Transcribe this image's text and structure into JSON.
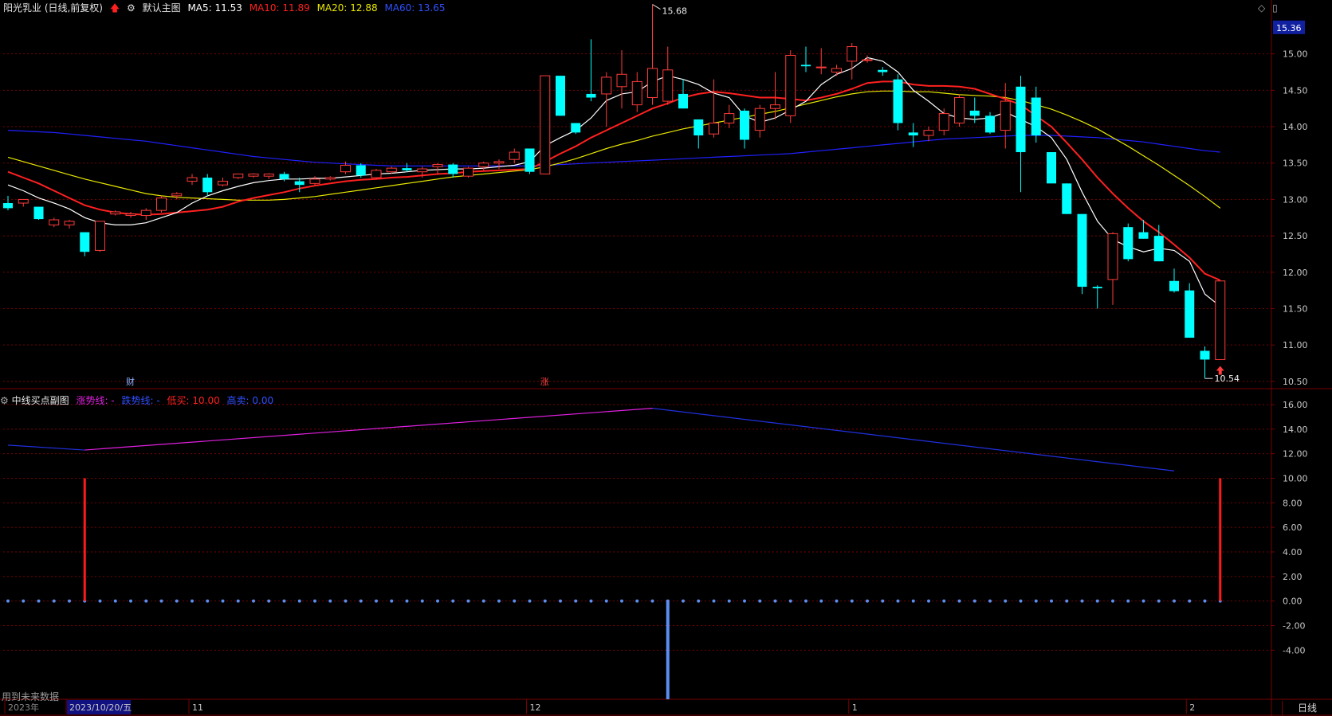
{
  "main_header": {
    "stock_name": "阳光乳业 (日线,前复权)",
    "template": "默认主图",
    "ma5_label": "MA5: 11.53",
    "ma10_label": "MA10: 11.89",
    "ma20_label": "MA20: 12.88",
    "ma60_label": "MA60: 13.65"
  },
  "sub_header": {
    "title": "中线买点副图",
    "rise_line": "涨势线: -",
    "fall_line": "跌势线: -",
    "low_buy": "低买: 10.00",
    "high_sell": "高卖: 0.00"
  },
  "status": {
    "future_data_note": "用到未来数据",
    "period_button": "日线"
  },
  "colors": {
    "bull": "#ff3b3b",
    "bear": "#00ffff",
    "ma5": "#ffffff",
    "ma10": "#ff2020",
    "ma20": "#e8e800",
    "ma60": "#2020ff",
    "rise": "#e020e0",
    "fall": "#2030e0",
    "grid": "#7a0000"
  },
  "chart_data": [
    {
      "type": "candlestick",
      "title": "阳光乳业 (日线,前复权)",
      "ylim": [
        10.4,
        15.5
      ],
      "y_ticks": [
        "15.00",
        "14.50",
        "14.00",
        "13.50",
        "13.00",
        "12.50",
        "12.00",
        "11.50",
        "11.00",
        "10.50"
      ],
      "last_price_label": "15.36",
      "high_annotation": "15.68",
      "low_annotation": "10.54",
      "event_markers": [
        {
          "text": "财",
          "index": 8
        },
        {
          "text": "涨",
          "index": 35
        }
      ],
      "x_labels": [
        {
          "text": "2023年",
          "index": 0
        },
        {
          "text": "2023/10/20/五",
          "index": 4
        },
        {
          "text": "11",
          "index": 12
        },
        {
          "text": "12",
          "index": 34
        },
        {
          "text": "1",
          "index": 55
        },
        {
          "text": "2",
          "index": 77
        }
      ],
      "ohlc": [
        [
          12.95,
          13.05,
          12.85,
          12.88
        ],
        [
          12.95,
          13.0,
          12.9,
          13.0
        ],
        [
          12.9,
          12.9,
          12.72,
          12.73
        ],
        [
          12.65,
          12.75,
          12.62,
          12.72
        ],
        [
          12.65,
          12.72,
          12.6,
          12.7
        ],
        [
          12.55,
          12.55,
          12.22,
          12.28
        ],
        [
          12.3,
          12.7,
          12.28,
          12.7
        ],
        [
          12.8,
          12.85,
          12.78,
          12.83
        ],
        [
          12.78,
          12.83,
          12.75,
          12.8
        ],
        [
          12.78,
          12.88,
          12.72,
          12.85
        ],
        [
          12.85,
          13.05,
          12.82,
          13.02
        ],
        [
          13.05,
          13.1,
          13.0,
          13.08
        ],
        [
          13.25,
          13.35,
          13.2,
          13.3
        ],
        [
          13.3,
          13.35,
          13.05,
          13.1
        ],
        [
          13.2,
          13.3,
          13.18,
          13.25
        ],
        [
          13.3,
          13.35,
          13.28,
          13.35
        ],
        [
          13.32,
          13.36,
          13.3,
          13.35
        ],
        [
          13.32,
          13.36,
          13.28,
          13.35
        ],
        [
          13.35,
          13.38,
          13.25,
          13.28
        ],
        [
          13.25,
          13.3,
          13.1,
          13.2
        ],
        [
          13.22,
          13.32,
          13.2,
          13.28
        ],
        [
          13.28,
          13.32,
          13.26,
          13.3
        ],
        [
          13.38,
          13.52,
          13.35,
          13.47
        ],
        [
          13.47,
          13.5,
          13.3,
          13.33
        ],
        [
          13.3,
          13.42,
          13.28,
          13.4
        ],
        [
          13.38,
          13.45,
          13.35,
          13.43
        ],
        [
          13.43,
          13.5,
          13.38,
          13.4
        ],
        [
          13.38,
          13.45,
          13.3,
          13.42
        ],
        [
          13.45,
          13.5,
          13.35,
          13.48
        ],
        [
          13.48,
          13.5,
          13.3,
          13.35
        ],
        [
          13.32,
          13.45,
          13.3,
          13.43
        ],
        [
          13.45,
          13.52,
          13.4,
          13.5
        ],
        [
          13.5,
          13.55,
          13.42,
          13.52
        ],
        [
          13.55,
          13.7,
          13.5,
          13.65
        ],
        [
          13.7,
          13.7,
          13.35,
          13.38
        ],
        [
          13.35,
          14.7,
          13.35,
          14.7
        ],
        [
          14.7,
          14.7,
          14.15,
          14.15
        ],
        [
          14.05,
          14.05,
          13.9,
          13.92
        ],
        [
          14.45,
          15.2,
          14.35,
          14.4
        ],
        [
          14.45,
          14.75,
          14.0,
          14.68
        ],
        [
          14.55,
          15.05,
          14.25,
          14.72
        ],
        [
          14.3,
          14.75,
          14.2,
          14.62
        ],
        [
          14.4,
          15.68,
          14.3,
          14.8
        ],
        [
          14.35,
          15.1,
          14.3,
          14.78
        ],
        [
          14.45,
          14.65,
          14.25,
          14.25
        ],
        [
          14.1,
          14.1,
          13.7,
          13.88
        ],
        [
          13.9,
          14.65,
          13.85,
          14.05
        ],
        [
          14.05,
          14.3,
          13.98,
          14.18
        ],
        [
          14.22,
          14.25,
          13.7,
          13.82
        ],
        [
          13.95,
          14.3,
          13.85,
          14.25
        ],
        [
          14.25,
          14.75,
          14.1,
          14.3
        ],
        [
          14.15,
          15.05,
          14.05,
          14.98
        ],
        [
          14.85,
          15.1,
          14.75,
          14.83
        ],
        [
          14.82,
          15.08,
          14.72,
          14.82
        ],
        [
          14.75,
          14.85,
          14.7,
          14.8
        ],
        [
          14.9,
          15.15,
          14.65,
          15.1
        ],
        [
          14.92,
          14.98,
          14.88,
          14.92
        ],
        [
          14.78,
          14.82,
          14.7,
          14.75
        ],
        [
          14.65,
          14.72,
          13.95,
          14.05
        ],
        [
          13.92,
          14.05,
          13.72,
          13.88
        ],
        [
          13.88,
          14.0,
          13.8,
          13.95
        ],
        [
          13.95,
          14.25,
          13.88,
          14.18
        ],
        [
          14.05,
          14.45,
          14.0,
          14.4
        ],
        [
          14.22,
          14.4,
          14.05,
          14.15
        ],
        [
          14.15,
          14.2,
          13.9,
          13.92
        ],
        [
          13.95,
          14.6,
          13.7,
          14.35
        ],
        [
          14.55,
          14.7,
          13.1,
          13.65
        ],
        [
          14.4,
          14.55,
          13.78,
          13.88
        ],
        [
          13.65,
          13.65,
          13.25,
          13.22
        ],
        [
          13.22,
          13.22,
          12.8,
          12.8
        ],
        [
          12.8,
          12.8,
          11.7,
          11.8
        ],
        [
          11.8,
          11.82,
          11.5,
          11.78
        ],
        [
          11.9,
          12.55,
          11.55,
          12.53
        ],
        [
          12.62,
          12.67,
          12.15,
          12.18
        ],
        [
          12.55,
          12.72,
          12.46,
          12.46
        ],
        [
          12.5,
          12.65,
          12.15,
          12.15
        ],
        [
          11.88,
          12.05,
          11.72,
          11.74
        ],
        [
          11.75,
          11.85,
          11.1,
          11.1
        ],
        [
          10.92,
          10.98,
          10.54,
          10.8
        ],
        [
          10.8,
          11.88,
          10.8,
          11.88
        ]
      ],
      "ma5": [
        13.2,
        13.12,
        13.02,
        12.95,
        12.87,
        12.75,
        12.68,
        12.65,
        12.65,
        12.68,
        12.75,
        12.82,
        12.95,
        13.05,
        13.12,
        13.18,
        13.23,
        13.26,
        13.28,
        13.28,
        13.29,
        13.29,
        13.31,
        13.33,
        13.35,
        13.36,
        13.38,
        13.4,
        13.41,
        13.42,
        13.42,
        13.43,
        13.45,
        13.47,
        13.52,
        13.74,
        13.85,
        13.95,
        14.12,
        14.36,
        14.45,
        14.48,
        14.62,
        14.7,
        14.65,
        14.58,
        14.46,
        14.4,
        14.15,
        14.06,
        14.12,
        14.23,
        14.35,
        14.58,
        14.72,
        14.8,
        14.95,
        14.9,
        14.75,
        14.5,
        14.35,
        14.18,
        14.12,
        14.1,
        14.12,
        14.2,
        14.1,
        14.0,
        13.85,
        13.55,
        13.1,
        12.7,
        12.45,
        12.35,
        12.28,
        12.33,
        12.3,
        12.15,
        11.7,
        11.53
      ],
      "ma10": [
        13.38,
        13.3,
        13.22,
        13.12,
        13.02,
        12.92,
        12.86,
        12.82,
        12.8,
        12.79,
        12.8,
        12.82,
        12.84,
        12.86,
        12.9,
        12.97,
        13.02,
        13.06,
        13.1,
        13.15,
        13.19,
        13.22,
        13.25,
        13.27,
        13.28,
        13.3,
        13.31,
        13.33,
        13.35,
        13.36,
        13.38,
        13.39,
        13.4,
        13.41,
        13.42,
        13.52,
        13.63,
        13.73,
        13.85,
        13.95,
        14.05,
        14.15,
        14.25,
        14.32,
        14.4,
        14.45,
        14.48,
        14.46,
        14.43,
        14.4,
        14.4,
        14.38,
        14.36,
        14.4,
        14.45,
        14.52,
        14.6,
        14.62,
        14.62,
        14.58,
        14.56,
        14.56,
        14.55,
        14.52,
        14.45,
        14.38,
        14.3,
        14.15,
        14.0,
        13.78,
        13.55,
        13.3,
        13.08,
        12.88,
        12.7,
        12.55,
        12.38,
        12.2,
        11.98,
        11.89
      ],
      "ma20": [
        13.58,
        13.52,
        13.46,
        13.4,
        13.34,
        13.28,
        13.23,
        13.18,
        13.13,
        13.08,
        13.05,
        13.03,
        13.02,
        13.01,
        13.0,
        12.99,
        12.99,
        12.99,
        13.0,
        13.02,
        13.04,
        13.07,
        13.1,
        13.13,
        13.16,
        13.19,
        13.22,
        13.25,
        13.28,
        13.31,
        13.33,
        13.35,
        13.37,
        13.39,
        13.41,
        13.45,
        13.5,
        13.56,
        13.63,
        13.7,
        13.76,
        13.81,
        13.87,
        13.92,
        13.97,
        14.01,
        14.05,
        14.09,
        14.13,
        14.17,
        14.21,
        14.26,
        14.31,
        14.36,
        14.41,
        14.45,
        14.48,
        14.49,
        14.49,
        14.48,
        14.48,
        14.46,
        14.44,
        14.43,
        14.42,
        14.4,
        14.36,
        14.3,
        14.24,
        14.16,
        14.07,
        13.97,
        13.85,
        13.73,
        13.6,
        13.47,
        13.33,
        13.19,
        13.04,
        12.88
      ],
      "ma60": [
        13.95,
        13.94,
        13.93,
        13.92,
        13.9,
        13.88,
        13.86,
        13.84,
        13.82,
        13.8,
        13.77,
        13.74,
        13.71,
        13.68,
        13.65,
        13.62,
        13.59,
        13.57,
        13.55,
        13.53,
        13.51,
        13.5,
        13.49,
        13.48,
        13.47,
        13.46,
        13.46,
        13.46,
        13.46,
        13.46,
        13.46,
        13.46,
        13.46,
        13.46,
        13.46,
        13.47,
        13.48,
        13.49,
        13.5,
        13.51,
        13.52,
        13.53,
        13.54,
        13.55,
        13.56,
        13.57,
        13.58,
        13.59,
        13.6,
        13.61,
        13.62,
        13.63,
        13.65,
        13.67,
        13.69,
        13.71,
        13.73,
        13.75,
        13.77,
        13.79,
        13.81,
        13.83,
        13.84,
        13.85,
        13.86,
        13.87,
        13.88,
        13.88,
        13.88,
        13.87,
        13.86,
        13.85,
        13.83,
        13.81,
        13.79,
        13.76,
        13.73,
        13.7,
        13.67,
        13.65
      ]
    },
    {
      "type": "line",
      "title": "中线买点副图",
      "ylim": [
        -8.0,
        16.0
      ],
      "y_ticks": [
        "16.00",
        "14.00",
        "12.00",
        "10.00",
        "8.00",
        "6.00",
        "4.00",
        "2.00",
        "0.00",
        "-2.00",
        "-4.00"
      ],
      "rise_series": {
        "from_index": 5,
        "to_index": 42,
        "values": [
          12.3,
          15.7
        ]
      },
      "fall_series": [
        {
          "from_index": 0,
          "to_index": 5,
          "values": [
            12.7,
            12.3
          ]
        },
        {
          "from_index": 42,
          "to_index": 76,
          "values": [
            15.7,
            10.6
          ]
        }
      ],
      "buy_bars": [
        {
          "index": 5,
          "value": 10.0
        },
        {
          "index": 79,
          "value": 10.0
        }
      ],
      "sell_bars": [
        {
          "index": 43,
          "value": -8.0
        }
      ],
      "zero_dots": 80
    }
  ]
}
